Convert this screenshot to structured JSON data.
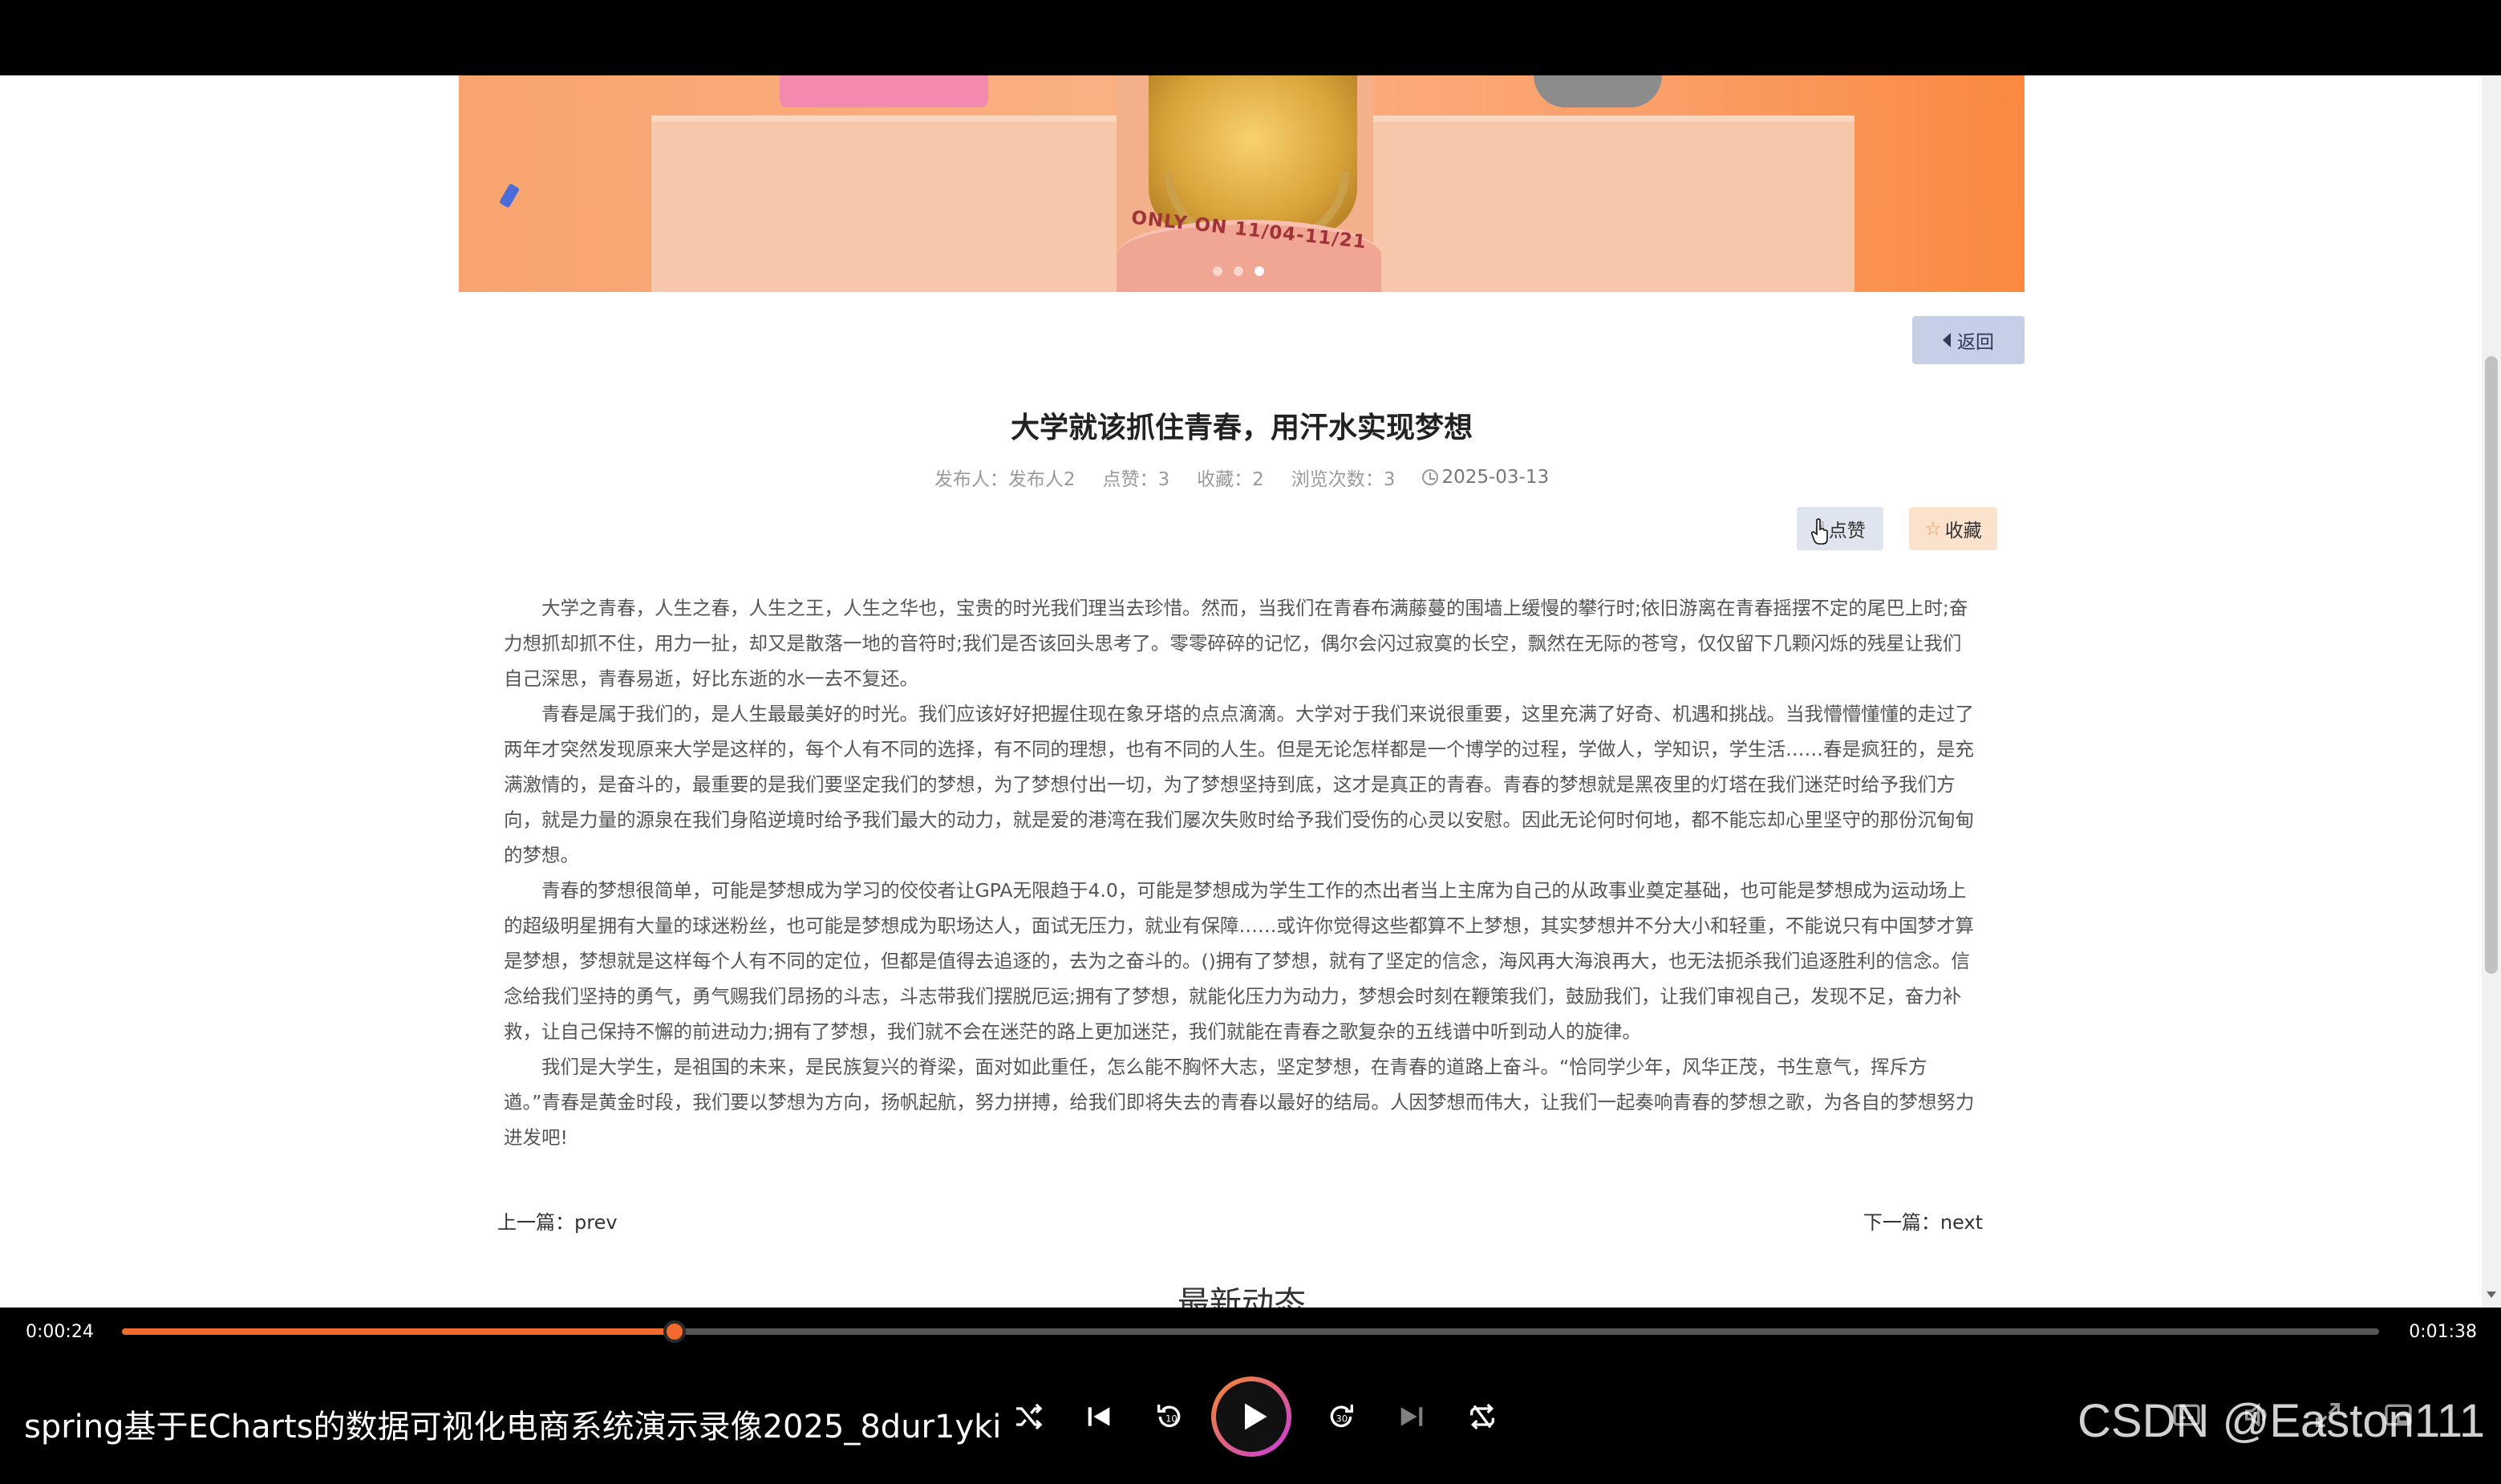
{
  "banner": {
    "promo_text": "ONLY ON 11/04-11/21",
    "dots": 3,
    "active_dot": 3
  },
  "page": {
    "back_label": "返回",
    "title": "大学就该抓住青春，用汗水实现梦想",
    "meta": {
      "publisher": "发布人：发布人2",
      "likes": "点赞：3",
      "collects": "收藏：2",
      "views": "浏览次数：3",
      "date": "2025-03-13"
    },
    "like_label": "点赞",
    "collect_label": "收藏",
    "paragraphs": [
      "大学之青春，人生之春，人生之王，人生之华也，宝贵的时光我们理当去珍惜。然而，当我们在青春布满藤蔓的围墙上缓慢的攀行时;依旧游离在青春摇摆不定的尾巴上时;奋力想抓却抓不住，用力一扯，却又是散落一地的音符时;我们是否该回头思考了。零零碎碎的记忆，偶尔会闪过寂寞的长空，飘然在无际的苍穹，仅仅留下几颗闪烁的残星让我们自己深思，青春易逝，好比东逝的水一去不复还。",
      "青春是属于我们的，是人生最最美好的时光。我们应该好好把握住现在象牙塔的点点滴滴。大学对于我们来说很重要，这里充满了好奇、机遇和挑战。当我懵懵懂懂的走过了两年才突然发现原来大学是这样的，每个人有不同的选择，有不同的理想，也有不同的人生。但是无论怎样都是一个博学的过程，学做人，学知识，学生活……春是疯狂的，是充满激情的，是奋斗的，最重要的是我们要坚定我们的梦想，为了梦想付出一切，为了梦想坚持到底，这才是真正的青春。青春的梦想就是黑夜里的灯塔在我们迷茫时给予我们方向，就是力量的源泉在我们身陷逆境时给予我们最大的动力，就是爱的港湾在我们屡次失败时给予我们受伤的心灵以安慰。因此无论何时何地，都不能忘却心里坚守的那份沉甸甸的梦想。",
      "青春的梦想很简单，可能是梦想成为学习的佼佼者让GPA无限趋于4.0，可能是梦想成为学生工作的杰出者当上主席为自己的从政事业奠定基础，也可能是梦想成为运动场上的超级明星拥有大量的球迷粉丝，也可能是梦想成为职场达人，面试无压力，就业有保障……或许你觉得这些都算不上梦想，其实梦想并不分大小和轻重，不能说只有中国梦才算是梦想，梦想就是这样每个人有不同的定位，但都是值得去追逐的，去为之奋斗的。()拥有了梦想，就有了坚定的信念，海风再大海浪再大，也无法扼杀我们追逐胜利的信念。信念给我们坚持的勇气，勇气赐我们昂扬的斗志，斗志带我们摆脱厄运;拥有了梦想，就能化压力为动力，梦想会时刻在鞭策我们，鼓励我们，让我们审视自己，发现不足，奋力补救，让自己保持不懈的前进动力;拥有了梦想，我们就不会在迷茫的路上更加迷茫，我们就能在青春之歌复杂的五线谱中听到动人的旋律。",
      "我们是大学生，是祖国的未来，是民族复兴的脊梁，面对如此重任，怎么能不胸怀大志，坚定梦想，在青春的道路上奋斗。“恰同学少年，风华正茂，书生意气，挥斥方遒。”青春是黄金时段，我们要以梦想为方向，扬帆起航，努力拼搏，给我们即将失去的青春以最好的结局。人因梦想而伟大，让我们一起奏响青春的梦想之歌，为各自的梦想努力进发吧!"
    ],
    "prev_link": "上一篇：prev",
    "next_link": "下一篇：next",
    "latest_heading": "最新动态"
  },
  "player": {
    "current_time": "0:00:24",
    "total_time": "0:01:38",
    "progress": 0.2449,
    "title": "spring基于ECharts的数据可视化电商系统演示录像2025_8dur1yki",
    "accent": "#f36a2e",
    "watermark": "CSDN @Easton111"
  },
  "icons": {
    "shuffle": "shuffle-icon",
    "prev": "skip-previous-icon",
    "rewind": "rewind-10-icon",
    "play": "play-icon",
    "forward": "forward-30-icon",
    "next": "skip-next-icon",
    "repeat": "repeat-icon"
  }
}
